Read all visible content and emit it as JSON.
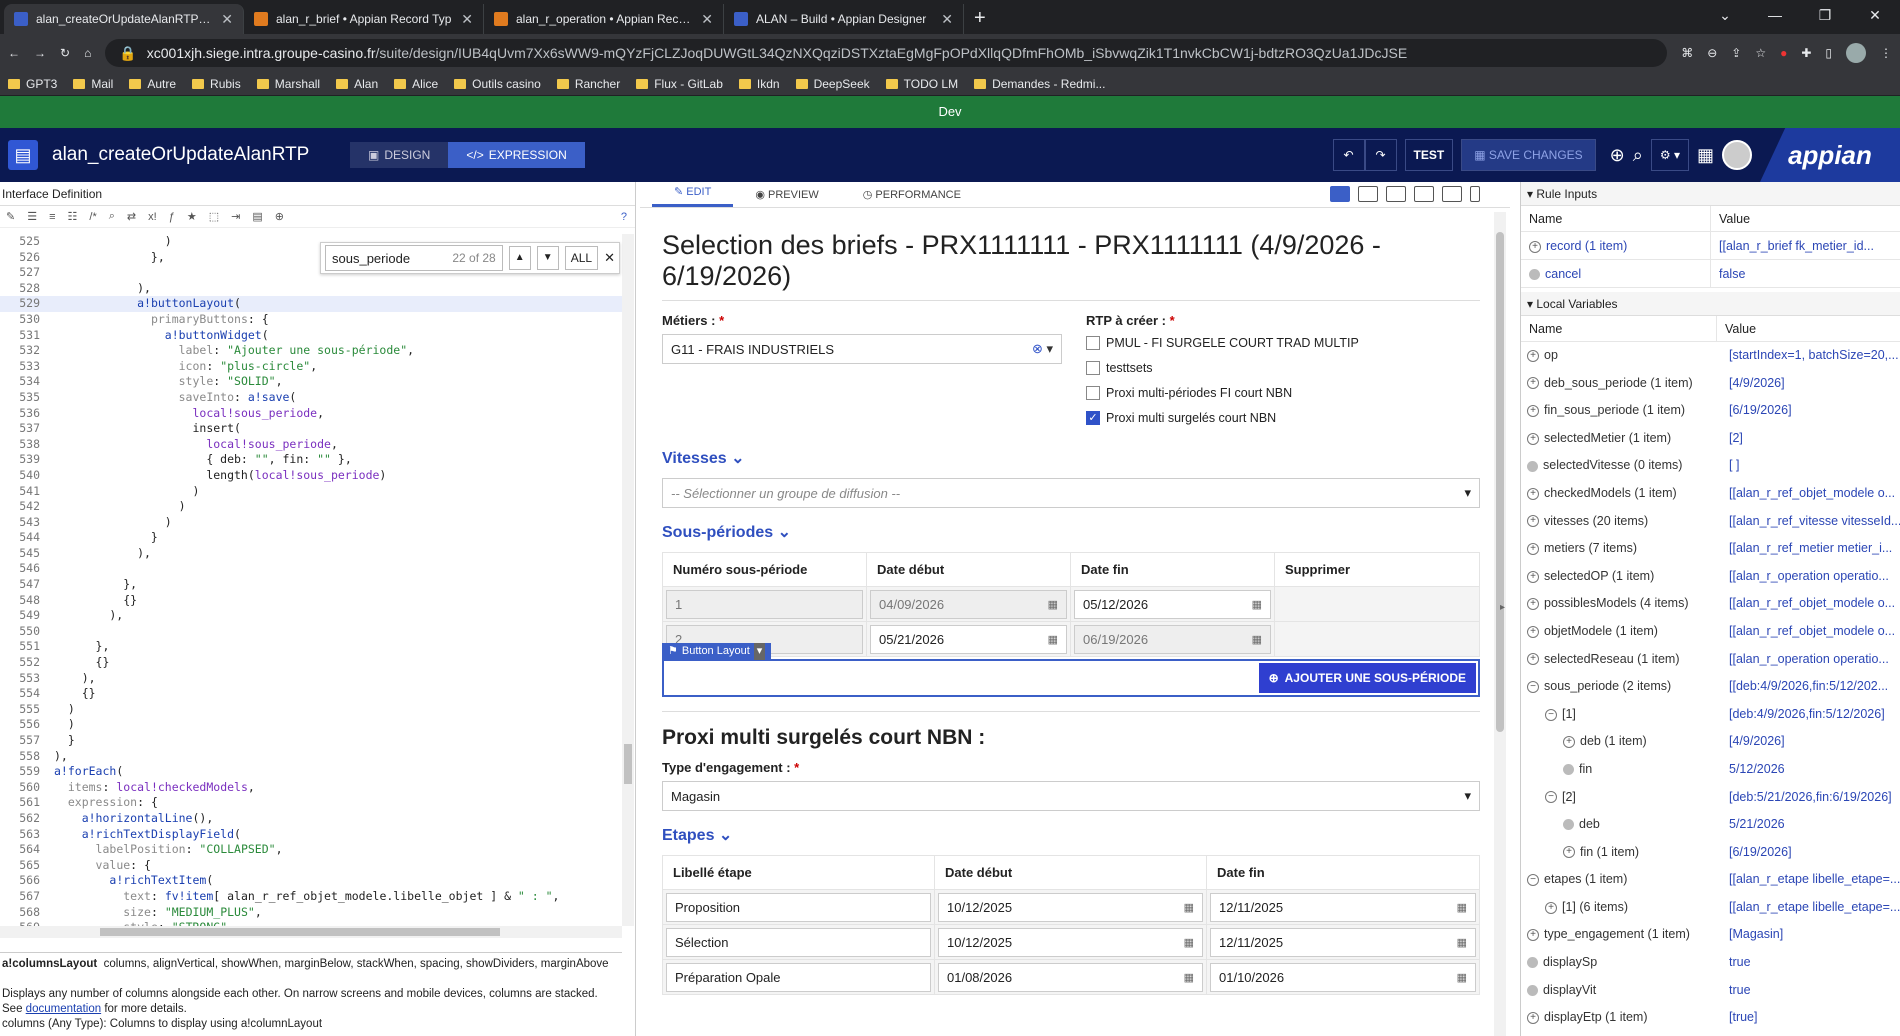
{
  "browser": {
    "tabs": [
      {
        "title": "alan_createOrUpdateAlanRTP • A",
        "color": "#3b5fc7"
      },
      {
        "title": "alan_r_brief • Appian Record Typ",
        "color": "#e07b1f"
      },
      {
        "title": "alan_r_operation • Appian Recorc",
        "color": "#e07b1f"
      },
      {
        "title": "ALAN – Build • Appian Designer",
        "color": "#3b5fc7"
      }
    ],
    "url_host": "xc001xjh.siege.intra.groupe-casino.fr",
    "url_path": "/suite/design/IUB4qUvm7Xx6sWW9-mQYzFjCLZJoqDUWGtL34QzNXQqziDSTXztaEgMgFpOPdXllqQDfmFhOMb_iSbvwqZik1T1nvkCbCW1j-bdtzRO3QzUa1JDcJSE",
    "bookmarks": [
      "GPT3",
      "Mail",
      "Autre",
      "Rubis",
      "Marshall",
      "Alan",
      "Alice",
      "Outils casino",
      "Rancher",
      "Flux - GitLab",
      "Ikdn",
      "DeepSeek",
      "TODO LM",
      "Demandes - Redmi..."
    ],
    "env_label": "Dev"
  },
  "header": {
    "object_name": "alan_createOrUpdateAlanRTP",
    "mode_design": "DESIGN",
    "mode_expression": "EXPRESSION",
    "test": "TEST",
    "save": "SAVE CHANGES",
    "brand": "appian"
  },
  "left": {
    "title": "Interface Definition",
    "find": {
      "query": "sous_periode",
      "count": "22 of 28",
      "all": "ALL"
    },
    "code": [
      {
        "n": "525",
        "t": "                )"
      },
      {
        "n": "526",
        "t": "              },"
      },
      {
        "n": "527",
        "t": ""
      },
      {
        "n": "528",
        "t": "            ),"
      },
      {
        "n": "529",
        "t": "            a!buttonLayout(",
        "hl": true
      },
      {
        "n": "530",
        "t": "              primaryButtons: {"
      },
      {
        "n": "531",
        "t": "                a!buttonWidget("
      },
      {
        "n": "532",
        "t": "                  label: \"Ajouter une sous-période\","
      },
      {
        "n": "533",
        "t": "                  icon: \"plus-circle\","
      },
      {
        "n": "534",
        "t": "                  style: \"SOLID\","
      },
      {
        "n": "535",
        "t": "                  saveInto: a!save("
      },
      {
        "n": "536",
        "t": "                    local!sous_periode,"
      },
      {
        "n": "537",
        "t": "                    insert("
      },
      {
        "n": "538",
        "t": "                      local!sous_periode,"
      },
      {
        "n": "539",
        "t": "                      { deb: \"\", fin: \"\" },"
      },
      {
        "n": "540",
        "t": "                      length(local!sous_periode)"
      },
      {
        "n": "541",
        "t": "                    )"
      },
      {
        "n": "542",
        "t": "                  )"
      },
      {
        "n": "543",
        "t": "                )"
      },
      {
        "n": "544",
        "t": "              }"
      },
      {
        "n": "545",
        "t": "            ),"
      },
      {
        "n": "546",
        "t": ""
      },
      {
        "n": "547",
        "t": "          },"
      },
      {
        "n": "548",
        "t": "          {}"
      },
      {
        "n": "549",
        "t": "        ),"
      },
      {
        "n": "550",
        "t": ""
      },
      {
        "n": "551",
        "t": "      },"
      },
      {
        "n": "552",
        "t": "      {}"
      },
      {
        "n": "553",
        "t": "    ),"
      },
      {
        "n": "554",
        "t": "    {}"
      },
      {
        "n": "555",
        "t": "  )"
      },
      {
        "n": "556",
        "t": "  )"
      },
      {
        "n": "557",
        "t": "  }"
      },
      {
        "n": "558",
        "t": "),"
      },
      {
        "n": "559",
        "t": "a!forEach("
      },
      {
        "n": "560",
        "t": "  items: local!checkedModels,"
      },
      {
        "n": "561",
        "t": "  expression: {"
      },
      {
        "n": "562",
        "t": "    a!horizontalLine(),"
      },
      {
        "n": "563",
        "t": "    a!richTextDisplayField("
      },
      {
        "n": "564",
        "t": "      labelPosition: \"COLLAPSED\","
      },
      {
        "n": "565",
        "t": "      value: {"
      },
      {
        "n": "566",
        "t": "        a!richTextItem("
      },
      {
        "n": "567",
        "t": "          text: fv!item[ alan_r_ref_objet_modele.libelle_objet ] & \" : \","
      },
      {
        "n": "568",
        "t": "          size: \"MEDIUM_PLUS\","
      },
      {
        "n": "569",
        "t": "          style: \"STRONG\""
      },
      {
        "n": "570",
        "t": ""
      }
    ],
    "doc_name": "a!columnsLayout",
    "doc_params": "columns, alignVertical, showWhen, marginBelow, stackWhen, spacing, showDividers, marginAbove",
    "doc_text": "Displays any number of columns alongside each other. On narrow screens and mobile devices, columns are stacked. See",
    "doc_link": "documentation",
    "doc_tail": "for more details.",
    "doc_cut": "columns (Any Type): Columns to display using a!columnLayout"
  },
  "center": {
    "tabs": [
      "EDIT",
      "PREVIEW",
      "PERFORMANCE"
    ],
    "title": "Selection des briefs - PRX1111111 - PRX1111111 (4/9/2026 - 6/19/2026)",
    "metiers_label": "Métiers :",
    "metiers_value": "G11 - FRAIS INDUSTRIELS",
    "rtp_label": "RTP à créer :",
    "rtp_options": [
      {
        "label": "PMUL - FI SURGELE COURT TRAD MULTIP",
        "checked": false
      },
      {
        "label": "testtsets",
        "checked": false
      },
      {
        "label": "Proxi multi-périodes FI court NBN",
        "checked": false
      },
      {
        "label": "Proxi multi surgelés court NBN",
        "checked": true
      }
    ],
    "vitesses_label": "Vitesses",
    "vitesses_placeholder": "-- Sélectionner un groupe de diffusion --",
    "sousperiodes_label": "Sous-périodes",
    "sp_headers": [
      "Numéro sous-période",
      "Date début",
      "Date fin",
      "Supprimer"
    ],
    "sp_rows": [
      {
        "num": "1",
        "deb": "04/09/2026",
        "fin": "05/12/2026"
      },
      {
        "num": "2",
        "deb": "05/21/2026",
        "fin": "06/19/2026"
      }
    ],
    "button_layout_tag": "Button Layout",
    "add_button": "AJOUTER UNE SOUS-PÉRIODE",
    "model_title": "Proxi multi surgelés court NBN :",
    "engagement_label": "Type d'engagement :",
    "engagement_value": "Magasin",
    "etapes_label": "Etapes",
    "et_headers": [
      "Libellé étape",
      "Date début",
      "Date fin"
    ],
    "et_rows": [
      {
        "lib": "Proposition",
        "deb": "10/12/2025",
        "fin": "12/11/2025"
      },
      {
        "lib": "Sélection",
        "deb": "10/12/2025",
        "fin": "12/11/2025"
      },
      {
        "lib": "Préparation Opale",
        "deb": "01/08/2026",
        "fin": "01/10/2026"
      }
    ]
  },
  "right": {
    "rule_inputs_title": "Rule Inputs",
    "col_name": "Name",
    "col_value": "Value",
    "rule_inputs": [
      {
        "n": "record (1 item)",
        "v": "[[alan_r_brief fk_metier_id..."
      },
      {
        "n": "cancel",
        "v": "false"
      }
    ],
    "local_title": "Local Variables",
    "locals": [
      {
        "n": "op",
        "v": "[startIndex=1, batchSize=20,...",
        "ic": "ex",
        "ind": 0
      },
      {
        "n": "deb_sous_periode (1 item)",
        "v": "[4/9/2026]",
        "ic": "ex",
        "ind": 0
      },
      {
        "n": "fin_sous_periode (1 item)",
        "v": "[6/19/2026]",
        "ic": "ex",
        "ind": 0
      },
      {
        "n": "selectedMetier (1 item)",
        "v": "[2]",
        "ic": "ex",
        "ind": 0
      },
      {
        "n": "selectedVitesse (0 items)",
        "v": "[ ]",
        "ic": "dot",
        "ind": 0
      },
      {
        "n": "checkedModels (1 item)",
        "v": "[[alan_r_ref_objet_modele o...",
        "ic": "ex",
        "ind": 0
      },
      {
        "n": "vitesses (20 items)",
        "v": "[[alan_r_ref_vitesse vitesseId...",
        "ic": "ex",
        "ind": 0
      },
      {
        "n": "metiers (7 items)",
        "v": "[[alan_r_ref_metier metier_i...",
        "ic": "ex",
        "ind": 0
      },
      {
        "n": "selectedOP (1 item)",
        "v": "[[alan_r_operation operatio...",
        "ic": "ex",
        "ind": 0
      },
      {
        "n": "possiblesModels (4 items)",
        "v": "[[alan_r_ref_objet_modele o...",
        "ic": "ex",
        "ind": 0
      },
      {
        "n": "objetModele (1 item)",
        "v": "[[alan_r_ref_objet_modele o...",
        "ic": "ex",
        "ind": 0
      },
      {
        "n": "selectedReseau (1 item)",
        "v": "[[alan_r_operation operatio...",
        "ic": "ex",
        "ind": 0
      },
      {
        "n": "sous_periode (2 items)",
        "v": "[[deb:4/9/2026,fin:5/12/202...",
        "ic": "col",
        "ind": 0
      },
      {
        "n": "[1]",
        "v": "[deb:4/9/2026,fin:5/12/2026]",
        "ic": "col",
        "ind": 1
      },
      {
        "n": "deb (1 item)",
        "v": "[4/9/2026]",
        "ic": "ex",
        "ind": 2
      },
      {
        "n": "fin",
        "v": "5/12/2026",
        "ic": "dot",
        "ind": 2
      },
      {
        "n": "[2]",
        "v": "[deb:5/21/2026,fin:6/19/2026]",
        "ic": "col",
        "ind": 1
      },
      {
        "n": "deb",
        "v": "5/21/2026",
        "ic": "dot",
        "ind": 2
      },
      {
        "n": "fin (1 item)",
        "v": "[6/19/2026]",
        "ic": "ex",
        "ind": 2
      },
      {
        "n": "etapes (1 item)",
        "v": "[[alan_r_etape libelle_etape=...",
        "ic": "col",
        "ind": 0
      },
      {
        "n": "[1] (6 items)",
        "v": "[[alan_r_etape libelle_etape=...",
        "ic": "ex",
        "ind": 1
      },
      {
        "n": "type_engagement (1 item)",
        "v": "[Magasin]",
        "ic": "ex",
        "ind": 0
      },
      {
        "n": "displaySp",
        "v": "true",
        "ic": "dot",
        "ind": 0
      },
      {
        "n": "displayVit",
        "v": "true",
        "ic": "dot",
        "ind": 0
      },
      {
        "n": "displayEtp (1 item)",
        "v": "[true]",
        "ic": "ex",
        "ind": 0
      }
    ]
  }
}
